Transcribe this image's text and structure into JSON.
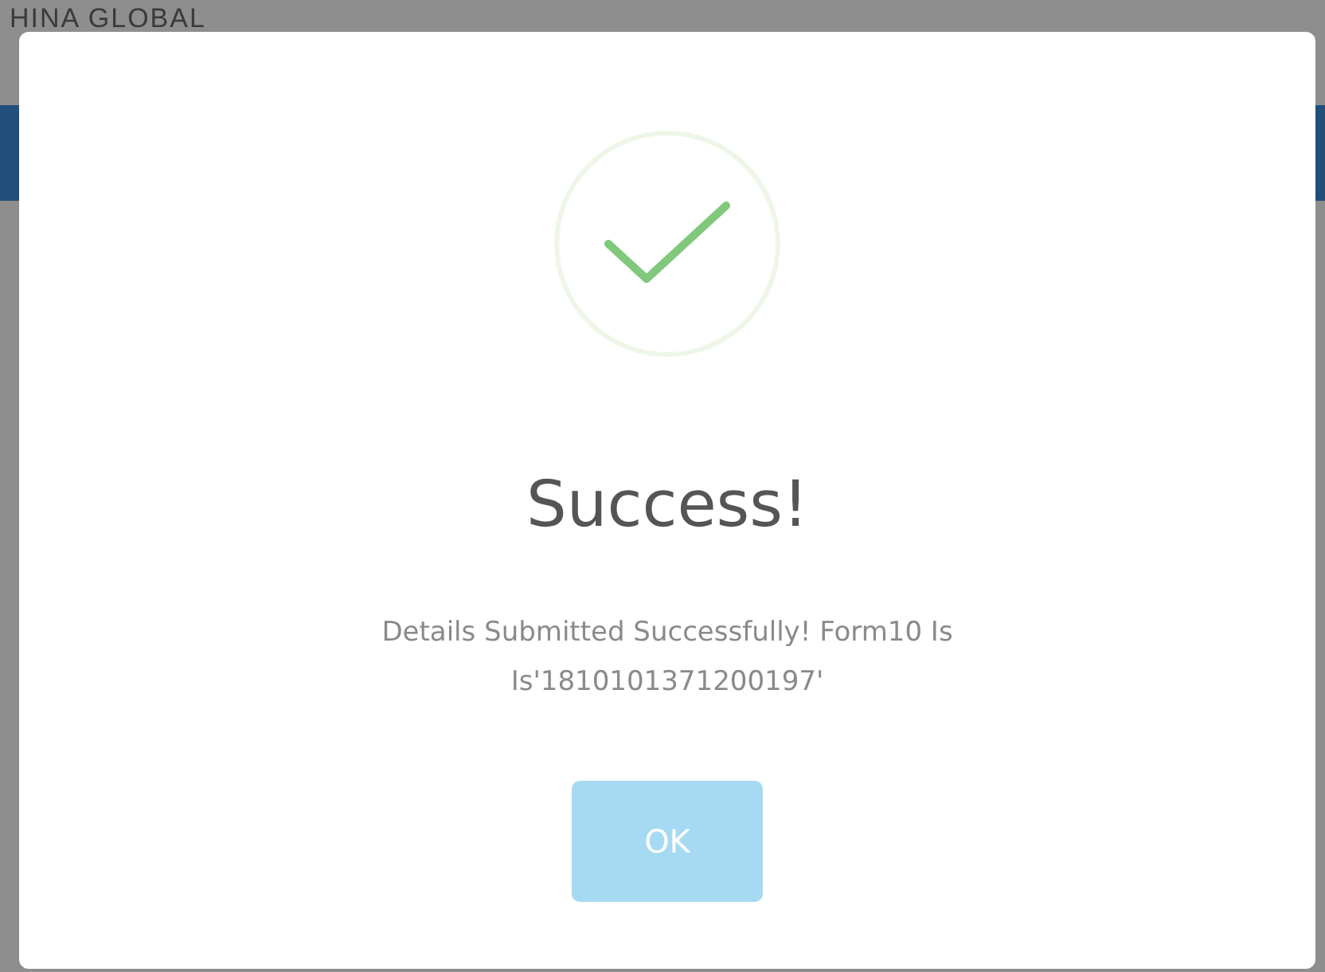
{
  "background": {
    "title": "HINA GLOBAL"
  },
  "dialog": {
    "title": "Success!",
    "message": "Details Submitted Successfully! Form10 Is Is'1810101371200197'",
    "button": "OK"
  }
}
